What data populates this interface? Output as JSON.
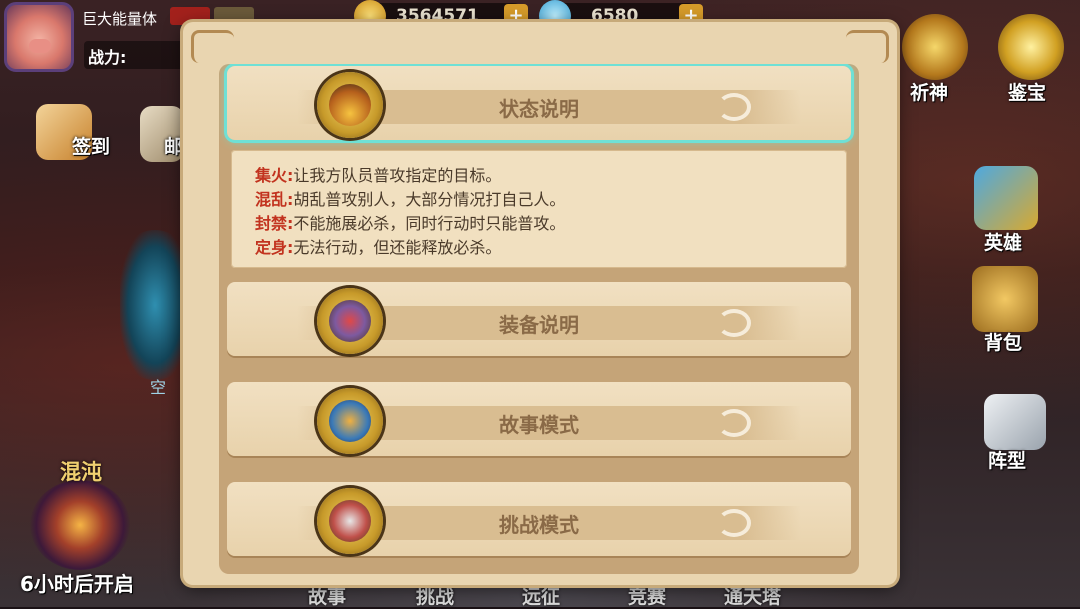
{
  "hud": {
    "player_name": "巨大能量体",
    "power_label": "战力:",
    "gold": "3564571",
    "gems": "6580",
    "plus": "+"
  },
  "left_menu": {
    "checkin": "签到",
    "mail": "邮",
    "portal": "空",
    "chaos_title": "混沌",
    "chaos_timer": "6小时后开启"
  },
  "right_menu": {
    "pray": "祈神",
    "treasure": "鉴宝",
    "hero": "英雄",
    "bag": "背包",
    "formation": "阵型"
  },
  "bottom_menu": [
    "故事",
    "挑战",
    "远征",
    "竞赛",
    "通天塔"
  ],
  "modal": {
    "sections": [
      {
        "title": "状态说明",
        "icon": "sleep-zzz-icon",
        "expanded": true
      },
      {
        "title": "装备说明",
        "icon": "armor-icon",
        "expanded": false
      },
      {
        "title": "故事模式",
        "icon": "scroll-icon",
        "expanded": false
      },
      {
        "title": "挑战模式",
        "icon": "crossed-swords-icon",
        "expanded": false
      }
    ],
    "status_desc": [
      {
        "key": "集火:",
        "text": "让我方队员普攻指定的目标。"
      },
      {
        "key": "混乱:",
        "text": "胡乱普攻别人，大部分情况打自己人。"
      },
      {
        "key": "封禁:",
        "text": "不能施展必杀，同时行动时只能普攻。"
      },
      {
        "key": "定身:",
        "text": "无法行动，但还能释放必杀。"
      }
    ]
  },
  "colors": {
    "active_glow": "#6fe0d5",
    "desc_key": "#c2331f",
    "section_title": "#8a6a47"
  }
}
